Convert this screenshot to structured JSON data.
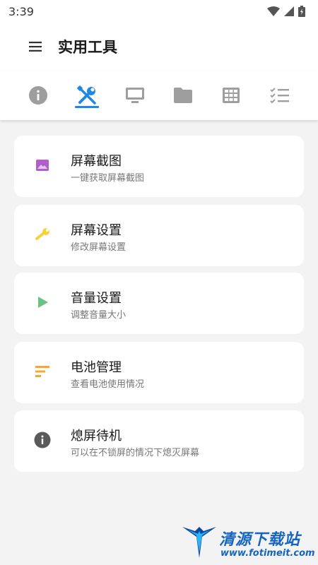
{
  "status_bar": {
    "time": "3:39"
  },
  "header": {
    "title": "实用工具"
  },
  "tabs": [
    {
      "icon": "info-icon"
    },
    {
      "icon": "tools-icon",
      "selected": true
    },
    {
      "icon": "monitor-icon"
    },
    {
      "icon": "folder-icon"
    },
    {
      "icon": "grid-icon"
    },
    {
      "icon": "checklist-icon"
    }
  ],
  "items": [
    {
      "title": "屏幕截图",
      "subtitle": "一键获取屏幕截图",
      "icon": "image-icon",
      "color": "#b05fc9"
    },
    {
      "title": "屏幕设置",
      "subtitle": "修改屏幕设置",
      "icon": "wrench-icon",
      "color": "#f5d13c"
    },
    {
      "title": "音量设置",
      "subtitle": "调整音量大小",
      "icon": "play-icon",
      "color": "#6cc184"
    },
    {
      "title": "电池管理",
      "subtitle": "查看电池使用情况",
      "icon": "sort-icon",
      "color": "#f7a630"
    },
    {
      "title": "熄屏待机",
      "subtitle": "可以在不锁屏的情况下熄灭屏幕",
      "icon": "info-icon",
      "color": "#5a5a5a"
    }
  ],
  "watermark": {
    "brand": "清源下载站",
    "url": "www.fotimeit.com"
  },
  "colors": {
    "accent": "#1e88e5",
    "icon_grey": "#9e9e9e",
    "background": "#f3f3f3"
  }
}
